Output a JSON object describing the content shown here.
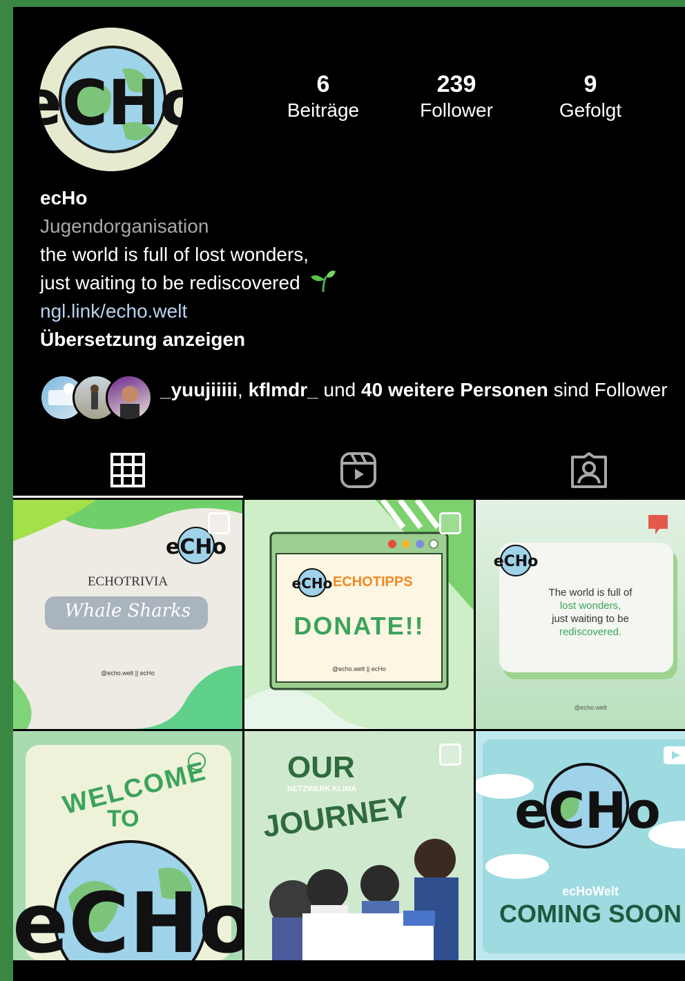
{
  "profile": {
    "name": "ecHo",
    "category": "Jugendorganisation",
    "bio_line1": "the world is full of lost wonders,",
    "bio_line2": "just waiting to be rediscovered",
    "bio_emoji": "seedling-icon",
    "link": "ngl.link/echo.welt",
    "translate_label": "Übersetzung anzeigen"
  },
  "stats": [
    {
      "value": "6",
      "label": "Beiträge"
    },
    {
      "value": "239",
      "label": "Follower"
    },
    {
      "value": "9",
      "label": "Gefolgt"
    }
  ],
  "followed_by": {
    "user1": "_yuujiiiii",
    "sep": ", ",
    "user2": "kflmdr_",
    "and": " und ",
    "others": "40 weitere Personen",
    "suffix": " sind Follower"
  },
  "tabs": [
    {
      "icon": "grid-icon"
    },
    {
      "icon": "reels-icon"
    },
    {
      "icon": "tagged-icon"
    }
  ],
  "posts": [
    {
      "title": "ECHOTRIVIA",
      "subtitle": "Whale Sharks",
      "handle": "@echo.welt || ecHo"
    },
    {
      "title": "ECHOTIPPS",
      "subtitle": "DONATE!!",
      "handle": "@echo.welt || ecHo"
    },
    {
      "line1": "The world is full of",
      "line2": "lost wonders,",
      "line3": "just waiting to be",
      "line4": "rediscovered.",
      "handle": "@echo.welt"
    },
    {
      "title": "WELCOME",
      "subtitle": "TO"
    },
    {
      "title": "OUR",
      "subtitle": "JOURNEY",
      "small": "NETZWERK KLIMA"
    },
    {
      "title": "ecHoWelt",
      "subtitle": "COMING SOON"
    }
  ],
  "colors": {
    "frame": "#3a8744",
    "link": "#b9d3f0",
    "accent_green": "#3aa45a",
    "accent_orange": "#f08a24"
  }
}
